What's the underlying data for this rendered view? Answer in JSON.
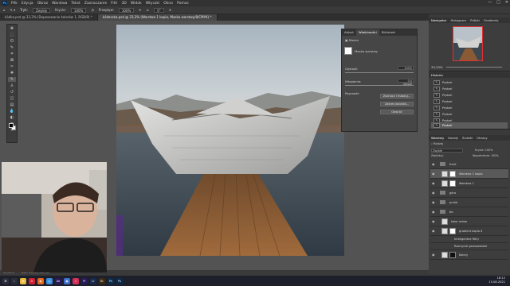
{
  "app": {
    "name": "Ps",
    "menu": [
      "Plik",
      "Edycja",
      "Obraz",
      "Warstwa",
      "Tekst",
      "Zaznaczanie",
      "Filtr",
      "3D",
      "Widok",
      "Wtyczki",
      "Okno",
      "Pomoc"
    ],
    "window_controls": [
      "—",
      "□",
      "✕"
    ]
  },
  "options_bar": {
    "mode_label": "Tryb:",
    "mode_value": "Zwykły",
    "opacity_label": "Krycie:",
    "opacity_value": "100%",
    "flow_label": "Przepływ:",
    "flow_value": "100%",
    "angle_value": "0°"
  },
  "tabs": [
    {
      "label": "Łódka.psd @ 33,3% (Dopasowanie kolorów 1, RGB/8) *",
      "active": false
    },
    {
      "label": "Łódeczka.psd @ 33,3% (Warstwa 1 kopia, Maska warstwy/8/CMYK) *",
      "active": true
    }
  ],
  "toolbar": {
    "tools": [
      "move-icon",
      "marquee-icon",
      "lasso-icon",
      "quick-select-icon",
      "crop-icon",
      "frame-icon",
      "eyedropper-icon",
      "healing-icon",
      "brush-icon",
      "stamp-icon",
      "history-brush-icon",
      "eraser-icon",
      "gradient-icon",
      "blur-icon",
      "dodge-icon",
      "pen-icon",
      "text-icon",
      "path-select-icon",
      "shape-icon",
      "hand-icon",
      "zoom-icon",
      "more-icon"
    ],
    "glyphs": [
      "✥",
      "⬚",
      "ʘ",
      "✎",
      "⌗",
      "⊠",
      "✑",
      "✚",
      "✎",
      "♙",
      "↺",
      "◫",
      "▤",
      "💧",
      "◐",
      "✒",
      "T",
      "➤",
      "▭",
      "✋",
      "🔍",
      "···"
    ]
  },
  "properties_panel": {
    "tabs": [
      "Adjust",
      "Właściwości",
      "Biblioteki"
    ],
    "section_icon_label": "Maska",
    "mask_label": "Maska warstwy",
    "density_label": "Gęstość:",
    "density_value": "100%",
    "feather_label": "Wtapianie:",
    "feather_value": "0,0 pikseli",
    "refine_label": "Poprawki:",
    "buttons": [
      "Zaznacz i maskuj...",
      "Zakres kolorów...",
      "Odwróć"
    ]
  },
  "navigator": {
    "tabs": [
      "Nawigator",
      "Histogram",
      "Próbki",
      "Gradienty"
    ],
    "zoom_value": "33,33%"
  },
  "history": {
    "title": "Historia",
    "items": [
      "Pędzel",
      "Pędzel",
      "Pędzel",
      "Pędzel",
      "Pędzel",
      "Pędzel",
      "Pędzel",
      "Pędzel"
    ]
  },
  "layers": {
    "tabs": [
      "Warstwy",
      "Kanały",
      "Ścieżki",
      "Obrazy"
    ],
    "filter_label": "Rodzaj",
    "blend_mode": "Zwykłe",
    "opacity_label": "Krycie:",
    "opacity_value": "100%",
    "lock_label": "Zablokuj:",
    "fill_label": "Wypełnienie:",
    "fill_value": "100%",
    "rows": [
      {
        "name": "front",
        "type": "folder",
        "sel": false
      },
      {
        "name": "Warstwa 1 kopia",
        "type": "layer-mask",
        "sel": true
      },
      {
        "name": "Warstwa 1",
        "type": "layer-mask",
        "sel": false
      },
      {
        "name": "góra",
        "type": "folder",
        "sel": false
      },
      {
        "name": "przód",
        "type": "folder",
        "sel": false
      },
      {
        "name": "tło",
        "type": "folder",
        "sel": false
      },
      {
        "name": "kolor nieba",
        "type": "layer",
        "sel": false
      },
      {
        "name": "gradient kopia 4",
        "type": "layer-mask",
        "sel": false
      },
      {
        "name": "Inteligentne filtry",
        "type": "sub",
        "sel": false
      },
      {
        "name": "Rozmycie gaussowskie",
        "type": "sub",
        "sel": false
      },
      {
        "name": "Kolory",
        "type": "layer-mask",
        "sel": false
      }
    ]
  },
  "status": {
    "zoom": "33,33%",
    "doc": "Dok: 24,9M/350,3M"
  },
  "taskbar": {
    "icons": [
      {
        "name": "start-icon",
        "glyph": "⊞",
        "color": "#2b2d3a"
      },
      {
        "name": "search-icon",
        "glyph": "⌕",
        "color": "#2b2d3a"
      },
      {
        "name": "explorer-icon",
        "glyph": "▤",
        "color": "#e8b93c"
      },
      {
        "name": "opera-icon",
        "glyph": "O",
        "color": "#d12030"
      },
      {
        "name": "firefox-icon",
        "glyph": "◉",
        "color": "#e66a1f"
      },
      {
        "name": "chrome-icon",
        "glyph": "◎",
        "color": "#3b8ee0"
      },
      {
        "name": "ae-icon",
        "glyph": "Ae",
        "color": "#2a1a5c"
      },
      {
        "name": "store-icon",
        "glyph": "▣",
        "color": "#3b6fd0"
      },
      {
        "name": "music-icon",
        "glyph": "♪",
        "color": "#d0305a"
      },
      {
        "name": "pr-icon",
        "glyph": "Pr",
        "color": "#2a1a5c"
      },
      {
        "name": "lr-icon",
        "glyph": "Lr",
        "color": "#1a2a4c"
      },
      {
        "name": "br-icon",
        "glyph": "Br",
        "color": "#3a2a10"
      },
      {
        "name": "ps-icon",
        "glyph": "Ps",
        "color": "#0b2b4c"
      },
      {
        "name": "ps2-icon",
        "glyph": "Ps",
        "color": "#0b2b4c"
      }
    ],
    "time": "18:12",
    "date": "15.08.2021"
  }
}
